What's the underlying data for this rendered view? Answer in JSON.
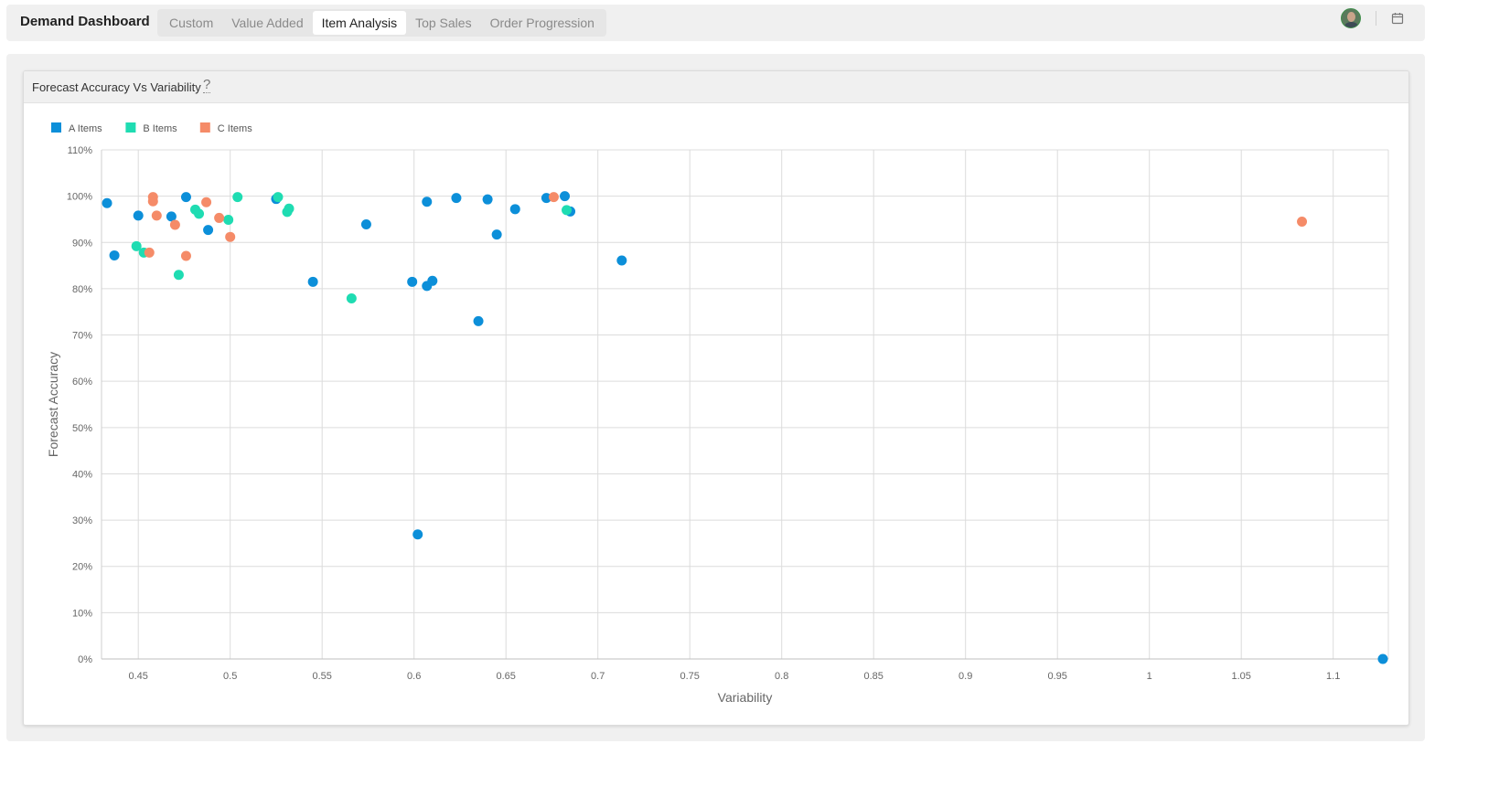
{
  "app": {
    "title": "Demand Dashboard",
    "tabs": [
      "Custom",
      "Value Added",
      "Item Analysis",
      "Top Sales",
      "Order Progression"
    ],
    "active_tab": "Item Analysis"
  },
  "header": {
    "avatar": "user-avatar",
    "calendar_icon": "calendar-icon"
  },
  "card": {
    "title": "Forecast Accuracy Vs Variability",
    "help_icon": "?"
  },
  "chart_data": {
    "type": "scatter",
    "title": "Forecast Accuracy Vs Variability",
    "xlabel": "Variability",
    "ylabel": "Forecast Accuracy",
    "xlim": [
      0.43,
      1.13
    ],
    "ylim": [
      0,
      110
    ],
    "x_ticks": [
      0.45,
      0.5,
      0.55,
      0.6,
      0.65,
      0.7,
      0.75,
      0.8,
      0.85,
      0.9,
      0.95,
      1,
      1.05,
      1.1
    ],
    "x_tick_labels": [
      "0.45",
      "0.5",
      "0.55",
      "0.6",
      "0.65",
      "0.7",
      "0.75",
      "0.8",
      "0.85",
      "0.9",
      "0.95",
      "1",
      "1.05",
      "1.1"
    ],
    "y_ticks": [
      0,
      10,
      20,
      30,
      40,
      50,
      60,
      70,
      80,
      90,
      100,
      110
    ],
    "y_tick_labels": [
      "0%",
      "10%",
      "20%",
      "30%",
      "40%",
      "50%",
      "60%",
      "70%",
      "80%",
      "90%",
      "100%",
      "110%"
    ],
    "grid": true,
    "legend_position": "top-left",
    "series": [
      {
        "name": "A Items",
        "color": "#0c8fd9",
        "points": [
          [
            0.433,
            98.5
          ],
          [
            0.437,
            87.2
          ],
          [
            0.45,
            95.8
          ],
          [
            0.468,
            95.6
          ],
          [
            0.476,
            99.8
          ],
          [
            0.488,
            92.7
          ],
          [
            0.525,
            99.4
          ],
          [
            0.545,
            81.5
          ],
          [
            0.574,
            93.9
          ],
          [
            0.599,
            81.5
          ],
          [
            0.602,
            26.9
          ],
          [
            0.607,
            80.6
          ],
          [
            0.607,
            98.8
          ],
          [
            0.61,
            81.7
          ],
          [
            0.623,
            99.6
          ],
          [
            0.635,
            73.0
          ],
          [
            0.64,
            99.3
          ],
          [
            0.645,
            91.7
          ],
          [
            0.655,
            97.2
          ],
          [
            0.672,
            99.6
          ],
          [
            0.682,
            100.0
          ],
          [
            0.685,
            96.7
          ],
          [
            0.713,
            86.1
          ],
          [
            1.127,
            0.0
          ]
        ]
      },
      {
        "name": "B Items",
        "color": "#1fdcb2",
        "points": [
          [
            0.449,
            89.2
          ],
          [
            0.453,
            87.8
          ],
          [
            0.472,
            83.0
          ],
          [
            0.481,
            97.1
          ],
          [
            0.483,
            96.2
          ],
          [
            0.499,
            94.9
          ],
          [
            0.504,
            99.8
          ],
          [
            0.526,
            99.8
          ],
          [
            0.531,
            96.6
          ],
          [
            0.532,
            97.3
          ],
          [
            0.566,
            77.9
          ],
          [
            0.683,
            97.0
          ]
        ]
      },
      {
        "name": "C Items",
        "color": "#f58b68",
        "points": [
          [
            0.456,
            87.8
          ],
          [
            0.458,
            98.9
          ],
          [
            0.458,
            99.8
          ],
          [
            0.46,
            95.8
          ],
          [
            0.47,
            93.8
          ],
          [
            0.476,
            87.1
          ],
          [
            0.487,
            98.7
          ],
          [
            0.494,
            95.3
          ],
          [
            0.5,
            91.2
          ],
          [
            0.676,
            99.8
          ],
          [
            1.083,
            94.5
          ]
        ]
      }
    ]
  }
}
